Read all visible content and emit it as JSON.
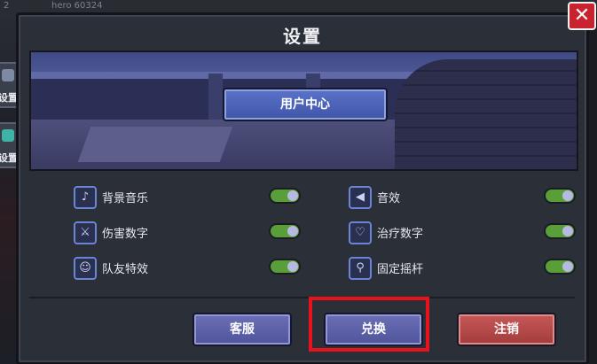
{
  "background": {
    "top_level": "2",
    "top_name": "hero 60324",
    "side_buttons": [
      "设置",
      "设置"
    ]
  },
  "dialog": {
    "title": "设置",
    "close_glyph": "✕"
  },
  "banner": {
    "user_center_label": "用户中心"
  },
  "settings": {
    "left": [
      {
        "label": "背景音乐",
        "icon": "music-note-icon",
        "glyph": "♪",
        "enabled": true
      },
      {
        "label": "伤害数字",
        "icon": "sword-icon",
        "glyph": "⚔",
        "enabled": true
      },
      {
        "label": "队友特效",
        "icon": "teammate-icon",
        "glyph": "☺",
        "enabled": true
      }
    ],
    "right": [
      {
        "label": "音效",
        "icon": "speaker-icon",
        "glyph": "◀",
        "enabled": true
      },
      {
        "label": "治疗数字",
        "icon": "heart-icon",
        "glyph": "♡",
        "enabled": true
      },
      {
        "label": "固定摇杆",
        "icon": "joystick-icon",
        "glyph": "⚲",
        "enabled": true
      }
    ]
  },
  "buttons": {
    "service": "客服",
    "redeem": "兑换",
    "logout": "注销"
  },
  "colors": {
    "toggle_on": "#5a9e3a",
    "logout": "#c85858",
    "highlight": "#e8121c"
  }
}
